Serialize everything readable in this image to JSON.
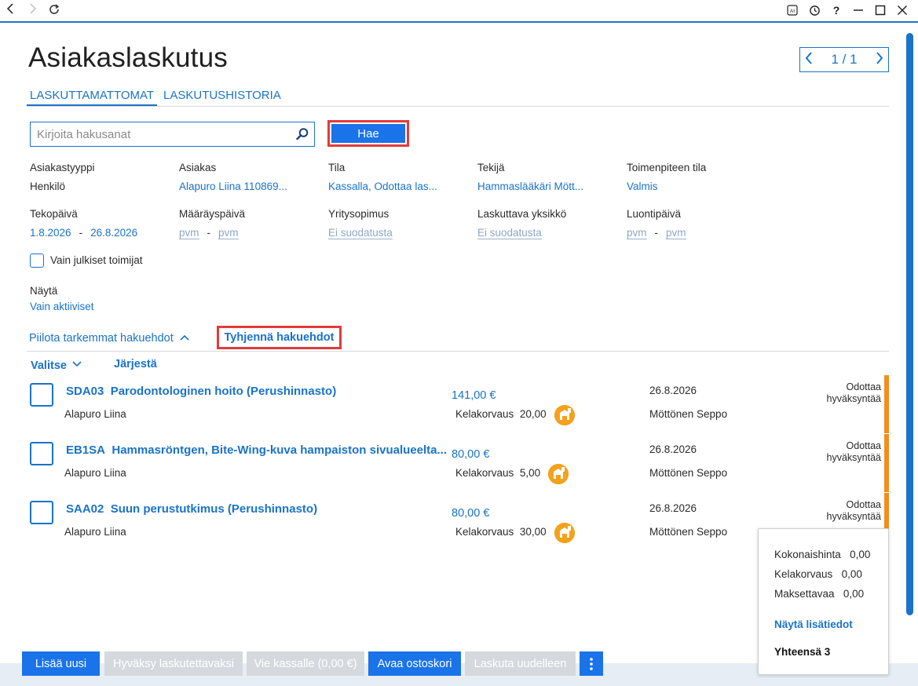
{
  "titlebar": {
    "back_icon": "chevron-left-icon",
    "forward_icon": "chevron-right-icon",
    "reload_icon": "reload-icon",
    "ai_label": "AI",
    "help_label": "?"
  },
  "page": {
    "title": "Asiakaslaskutus",
    "pager": "1 / 1"
  },
  "tabs": [
    {
      "label": "LASKUTTAMATTOMAT"
    },
    {
      "label": "LASKUTUSHISTORIA"
    }
  ],
  "search": {
    "placeholder": "Kirjoita hakusanat",
    "button_label": "Hae"
  },
  "filters": {
    "asiakastyyppi": {
      "label": "Asiakastyyppi",
      "value": "Henkilö"
    },
    "asiakas": {
      "label": "Asiakas",
      "value": "Alapuro Liina 110869..."
    },
    "tila": {
      "label": "Tila",
      "value": "Kassalla, Odottaa las..."
    },
    "tekija": {
      "label": "Tekijä",
      "value": "Hammaslääkäri Mött..."
    },
    "toimenpiteen_tila": {
      "label": "Toimenpiteen tila",
      "value": "Valmis"
    },
    "tekopaiva": {
      "label": "Tekopäivä",
      "from": "1.8.2026",
      "to": "26.8.2026"
    },
    "maarayspaiva": {
      "label": "Määräyspäivä",
      "from": "pvm",
      "to": "pvm"
    },
    "yritysopimus": {
      "label": "Yritysopimus",
      "value": "Ei suodatusta"
    },
    "laskuttava_yksikko": {
      "label": "Laskuttava yksikkö",
      "value": "Ei suodatusta"
    },
    "luontipaiva": {
      "label": "Luontipäivä",
      "from": "pvm",
      "to": "pvm"
    },
    "dash": "-",
    "julkiset_label": "Vain julkiset toimijat",
    "nayta": {
      "label": "Näytä",
      "value": "Vain aktiiviset"
    }
  },
  "actions": {
    "hide_filters": "Piilota tarkemmat hakuehdot",
    "clear_filters": "Tyhjennä hakuehdot",
    "select": "Valitse",
    "sort": "Järjestä"
  },
  "rows": [
    {
      "code": "SDA03",
      "name": "Parodontologinen hoito (Perushinnasto)",
      "patient": "Alapuro Liina",
      "price": "141,00 €",
      "kela_label": "Kelakorvaus",
      "kela_value": "20,00",
      "date": "26.8.2026",
      "doctor": "Möttönen Seppo",
      "status_line1": "Odottaa",
      "status_line2": "hyväksyntää"
    },
    {
      "code": "EB1SA",
      "name": "Hammasröntgen, Bite-Wing-kuva hampaiston sivualueelta...",
      "patient": "Alapuro Liina",
      "price": "80,00 €",
      "kela_label": "Kelakorvaus",
      "kela_value": "5,00",
      "date": "26.8.2026",
      "doctor": "Möttönen Seppo",
      "status_line1": "Odottaa",
      "status_line2": "hyväksyntää"
    },
    {
      "code": "SAA02",
      "name": "Suun perustutkimus (Perushinnasto)",
      "patient": "Alapuro Liina",
      "price": "80,00 €",
      "kela_label": "Kelakorvaus",
      "kela_value": "30,00",
      "date": "26.8.2026",
      "doctor": "Möttönen Seppo",
      "status_line1": "Odottaa",
      "status_line2": "hyväksyntää"
    }
  ],
  "summary": {
    "kokonaishinta_label": "Kokonaishinta",
    "kokonaishinta_value": "0,00",
    "kelakorvaus_label": "Kelakorvaus",
    "kelakorvaus_value": "0,00",
    "maksettavaa_label": "Maksettavaa",
    "maksettavaa_value": "0,00",
    "details_link": "Näytä lisätiedot",
    "total": "Yhteensä 3"
  },
  "bottom_buttons": {
    "add_new": "Lisää uusi",
    "approve": "Hyväksy laskutettavaksi",
    "to_cashier": "Vie kassalle (0,00 €)",
    "open_cart": "Avaa ostoskori",
    "reinvoice": "Laskuta uudelleen",
    "more_icon": "more-vertical-icon"
  },
  "colors": {
    "accent": "#1a73c9",
    "primary_button": "#1a73e8",
    "highlight_border": "#e23b3b",
    "status_stripe": "#f58c1e",
    "badge": "#f4a11c",
    "disabled_button": "#d5d9de"
  }
}
